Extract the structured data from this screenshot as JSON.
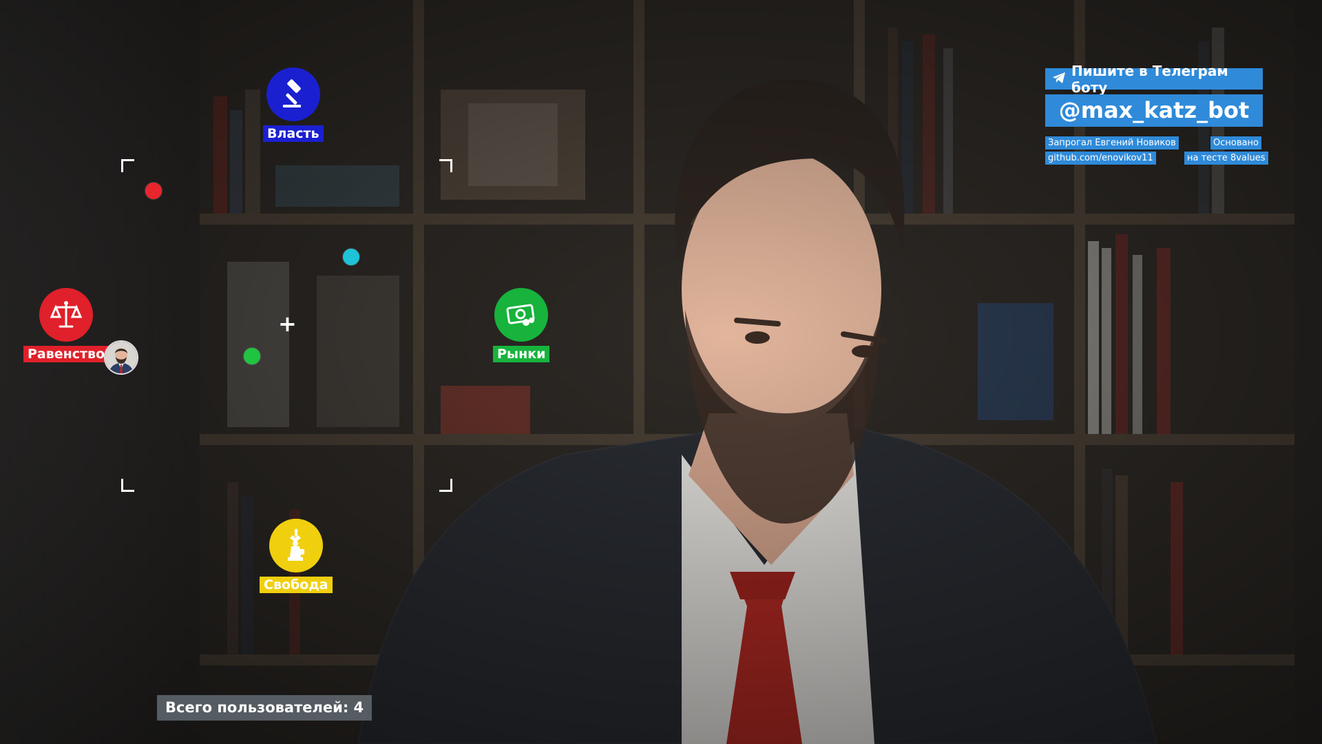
{
  "axes": {
    "vlast": {
      "label": "Власть",
      "color": "#1a20d0",
      "icon": "gavel-icon"
    },
    "ravenstvo": {
      "label": "Равенство",
      "color": "#e0202a",
      "icon": "scales-icon"
    },
    "rynki": {
      "label": "Рынки",
      "color": "#17b33c",
      "icon": "money-icon"
    },
    "svoboda": {
      "label": "Свобода",
      "color": "#f0cf0f",
      "icon": "statue-of-liberty-icon"
    }
  },
  "markers": {
    "red_dot": "#e8252c",
    "cyan_dot": "#1ec3d8",
    "green_dot": "#1fc441",
    "avatar": "avatar"
  },
  "telegram": {
    "prompt": "Пишите в Телеграм боту",
    "handle": "@max_katz_bot",
    "icon": "telegram-plane-icon",
    "color": "#2f8ad9"
  },
  "credits": {
    "author": "Запрогал Евгений Новиков",
    "github": "github.com/enovikov11",
    "based_on_1": "Основано",
    "based_on_2": "на тесте 8values"
  },
  "footer": {
    "users_total": "Всего пользователей: 4"
  }
}
